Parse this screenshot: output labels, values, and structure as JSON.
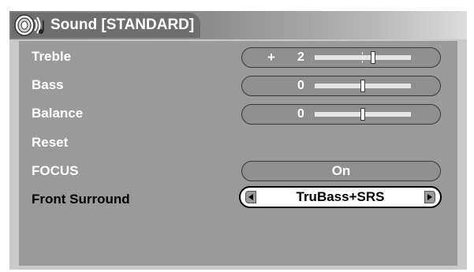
{
  "header": {
    "title": "Sound [STANDARD]"
  },
  "items": [
    {
      "label": "Treble",
      "sign": "+",
      "value": "2",
      "level": 2
    },
    {
      "label": "Bass",
      "sign": "",
      "value": "0",
      "level": 0
    },
    {
      "label": "Balance",
      "sign": "",
      "value": "0",
      "level": 0
    },
    {
      "label": "Reset"
    },
    {
      "label": "FOCUS",
      "value": "On"
    },
    {
      "label": "Front Surround",
      "value": "TruBass+SRS"
    }
  ],
  "colors": {
    "panel": "#c9c9c9",
    "body": "#9a9a9a",
    "header_tab": "#6e6e6e",
    "text_light": "#ffffff",
    "text_selected": "#000000"
  },
  "icons": {
    "header": "speaker-icon",
    "prev": "left-arrow-icon",
    "next": "right-arrow-icon"
  }
}
